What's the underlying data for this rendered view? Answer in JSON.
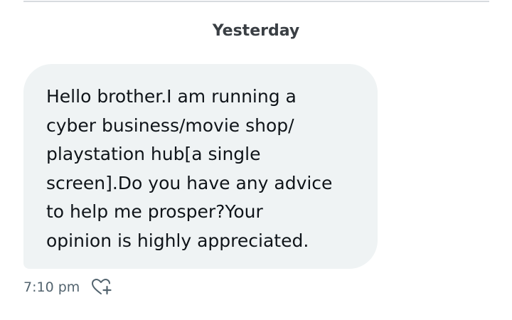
{
  "date_separator": "Yesterday",
  "message": {
    "text": "Hello brother.I am running a\ncyber business/movie shop/\nplaystation hub[a single\nscreen].Do you have any advice\nto help me prosper?Your\nopinion is highly appreciated.",
    "timestamp": "7:10 pm",
    "react_icon": "heart-plus-icon"
  },
  "colors": {
    "bubble_bg": "#eff3f4",
    "text": "#0f1419",
    "meta_text": "#53646f",
    "divider": "#d7dbdf"
  }
}
